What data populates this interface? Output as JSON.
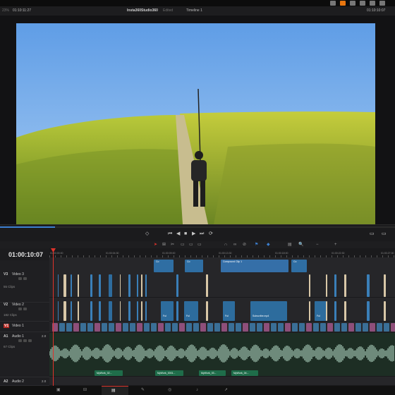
{
  "viewer": {
    "zoom": "23%",
    "source_timecode": "01:10:11:27",
    "project_name": "Insta360Studio360",
    "project_status": "Edited",
    "timeline_name": "Timeline 1",
    "record_timecode": "01:10:10:07"
  },
  "timeline": {
    "timecode": "01:00:10:07",
    "ruler_labels": [
      "01:00:00:00",
      "01:00:04:30",
      "01:00:09:00",
      "01:00:13:30",
      "01:00:18:00",
      "01:00:22:30",
      "01:00:27:00"
    ]
  },
  "tracks": [
    {
      "id": "V3",
      "name": "Video 3",
      "count": "55 Clips"
    },
    {
      "id": "V2",
      "name": "Video 2",
      "count": "182 Clips"
    },
    {
      "id": "V1",
      "name": "Video 1",
      "count": ""
    },
    {
      "id": "A1",
      "name": "Audio 1",
      "level": "2.0",
      "count": "67 Clips"
    },
    {
      "id": "A2",
      "name": "Audio 2",
      "level": "2.0"
    }
  ],
  "clip_labels": {
    "v3_a": "Co",
    "v3_b": "Co",
    "compound": "Compound Clip 1",
    "v3_c": "Co",
    "v2_a": "Ful",
    "v2_b": "Ful",
    "v2_c": "Ful",
    "v2_d": "Subscribe.mp4",
    "v2_e": "Ful",
    "a1_a": "MyWork_02...",
    "a1_b": "MyWork_0001...",
    "a1_c": "MyWork_03...",
    "a1_d": "MyWork_04..."
  },
  "icons": {
    "apple": "apple-icon",
    "orange": "highlight-icon",
    "transport_prev": "jump-start-icon",
    "transport_back": "step-back-icon",
    "transport_stop": "stop-icon",
    "transport_play": "play-icon",
    "transport_fwd": "step-forward-icon",
    "transport_loop": "loop-icon"
  },
  "pages": [
    "Media",
    "Cut",
    "Edit",
    "Fusion",
    "Color",
    "Fairlight",
    "Deliver"
  ],
  "accent": "#e0332b"
}
